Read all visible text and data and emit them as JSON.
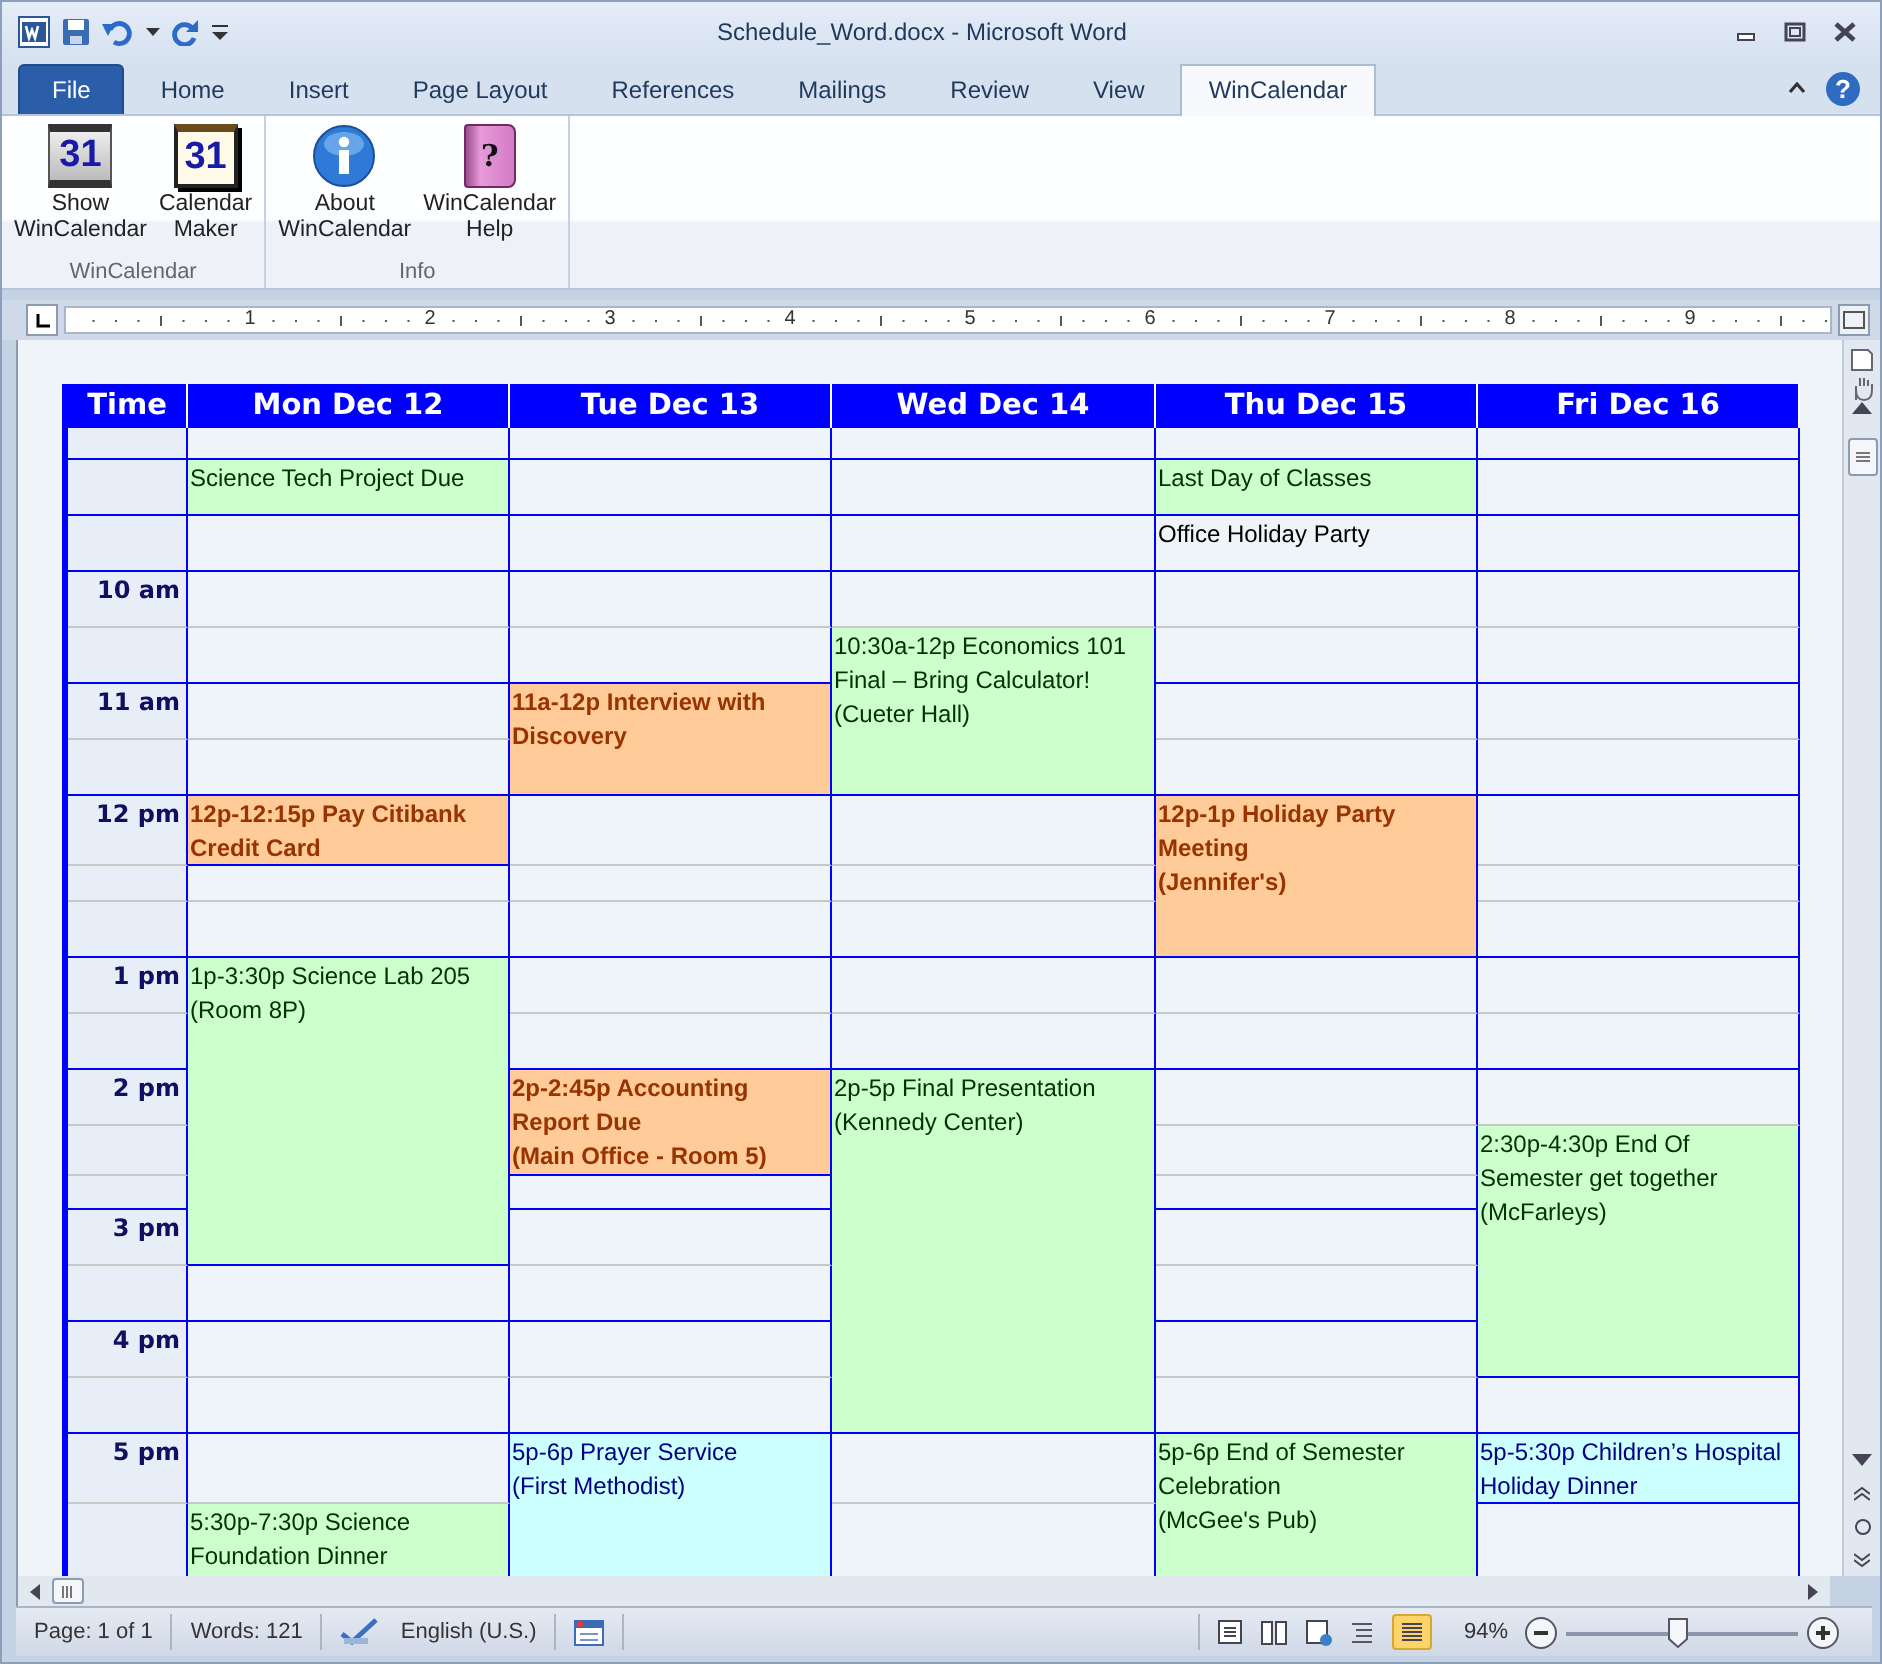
{
  "window": {
    "title": "Schedule_Word.docx - Microsoft Word"
  },
  "ribbon_tabs": [
    {
      "label": "File",
      "kind": "file",
      "selected": false
    },
    {
      "label": "Home",
      "kind": "tab",
      "selected": false
    },
    {
      "label": "Insert",
      "kind": "tab",
      "selected": false
    },
    {
      "label": "Page Layout",
      "kind": "tab",
      "selected": false
    },
    {
      "label": "References",
      "kind": "tab",
      "selected": false
    },
    {
      "label": "Mailings",
      "kind": "tab",
      "selected": false
    },
    {
      "label": "Review",
      "kind": "tab",
      "selected": false
    },
    {
      "label": "View",
      "kind": "tab",
      "selected": false
    },
    {
      "label": "WinCalendar",
      "kind": "tab",
      "selected": true
    }
  ],
  "help_button": {
    "text": "?"
  },
  "ribbon_groups": [
    {
      "label": "WinCalendar",
      "buttons": [
        {
          "label": "Show WinCalendar",
          "icon_text": "31"
        },
        {
          "label": "Calendar Maker",
          "icon_text": "31"
        }
      ]
    },
    {
      "label": "Info",
      "buttons": [
        {
          "label": "About WinCalendar"
        },
        {
          "label": "WinCalendar Help",
          "icon_text": "?"
        }
      ]
    }
  ],
  "ruler": {
    "labels": [
      "1",
      "2",
      "3",
      "4",
      "5",
      "6",
      "7",
      "8",
      "9"
    ]
  },
  "calendar": {
    "time_header": "Time",
    "columns": [
      "Mon Dec 12",
      "Tue Dec 13",
      "Wed Dec 14",
      "Thu Dec 15",
      "Fri Dec 16"
    ],
    "rows": [
      {
        "kind": "allday",
        "cells": [
          {
            "kind": "empty"
          },
          {
            "kind": "empty"
          },
          {
            "kind": "empty"
          },
          {
            "kind": "empty"
          },
          {
            "kind": "empty"
          }
        ]
      },
      {
        "kind": "allday",
        "cells": [
          {
            "kind": "event",
            "lines": [
              "Science Tech Project Due"
            ],
            "color": "#ccffcc",
            "bold": false
          },
          {
            "kind": "empty"
          },
          {
            "kind": "empty"
          },
          {
            "kind": "event",
            "lines": [
              "Last Day of Classes"
            ],
            "color": "#ccffcc",
            "bold": false
          },
          {
            "kind": "empty"
          }
        ]
      },
      {
        "kind": "allday",
        "cells": [
          {
            "kind": "empty"
          },
          {
            "kind": "empty"
          },
          {
            "kind": "empty"
          },
          {
            "kind": "event",
            "lines": [
              "Office Holiday Party"
            ],
            "bold": false
          },
          {
            "kind": "empty"
          }
        ]
      },
      {
        "kind": "slot",
        "time": "10 am",
        "cells": [
          {
            "kind": "empty"
          },
          {
            "kind": "empty"
          },
          {
            "kind": "empty"
          },
          {
            "kind": "empty"
          },
          {
            "kind": "empty"
          }
        ]
      },
      {
        "kind": "slot",
        "cells": [
          {
            "kind": "empty"
          },
          {
            "kind": "empty"
          },
          {
            "kind": "event",
            "lines": [
              "10:30a-12p Economics 101 Final – Bring Calculator!",
              "(Cueter Hall)"
            ],
            "color": "#ccffcc",
            "bold": false
          },
          {
            "kind": "empty"
          },
          {
            "kind": "empty"
          }
        ]
      },
      {
        "kind": "slot",
        "time": "11 am",
        "cells": [
          {
            "kind": "empty"
          },
          {
            "kind": "event",
            "lines": [
              "11a-12p Interview with Discovery"
            ],
            "color": "#ffcc99",
            "bold": true
          },
          {
            "kind": "continued"
          },
          {
            "kind": "empty"
          },
          {
            "kind": "empty"
          }
        ]
      },
      {
        "kind": "slot",
        "cells": [
          {
            "kind": "empty"
          },
          {
            "kind": "continued"
          },
          {
            "kind": "continued"
          },
          {
            "kind": "empty"
          },
          {
            "kind": "empty"
          }
        ]
      },
      {
        "kind": "slot",
        "time": "12 pm",
        "cells": [
          {
            "kind": "event",
            "lines": [
              "12p-12:15p Pay Citibank Credit Card"
            ],
            "color": "#ffcc99",
            "bold": true
          },
          {
            "kind": "empty"
          },
          {
            "kind": "empty"
          },
          {
            "kind": "event",
            "lines": [
              "12p-1p Holiday Party Meeting",
              "(Jennifer's)"
            ],
            "color": "#ffcc99",
            "bold": true
          },
          {
            "kind": "empty"
          }
        ]
      },
      {
        "kind": "slot",
        "cells": [
          {
            "kind": "empty"
          },
          {
            "kind": "empty"
          },
          {
            "kind": "empty"
          },
          {
            "kind": "continued"
          },
          {
            "kind": "empty"
          }
        ]
      },
      {
        "kind": "slot",
        "cells": [
          {
            "kind": "empty"
          },
          {
            "kind": "empty"
          },
          {
            "kind": "empty"
          },
          {
            "kind": "continued"
          },
          {
            "kind": "empty"
          }
        ]
      },
      {
        "kind": "slot",
        "time": "1 pm",
        "cells": [
          {
            "kind": "event",
            "lines": [
              "1p-3:30p Science Lab 205",
              "(Room 8P)"
            ],
            "color": "#ccffcc",
            "bold": false
          },
          {
            "kind": "empty"
          },
          {
            "kind": "empty"
          },
          {
            "kind": "empty"
          },
          {
            "kind": "empty"
          }
        ]
      },
      {
        "kind": "slot",
        "cells": [
          {
            "kind": "continued"
          },
          {
            "kind": "empty"
          },
          {
            "kind": "empty"
          },
          {
            "kind": "empty"
          },
          {
            "kind": "empty"
          }
        ]
      },
      {
        "kind": "slot",
        "time": "2 pm",
        "cells": [
          {
            "kind": "continued"
          },
          {
            "kind": "event",
            "lines": [
              "2p-2:45p Accounting Report Due",
              "(Main Office - Room 5)"
            ],
            "color": "#ffcc99",
            "bold": true
          },
          {
            "kind": "event",
            "lines": [
              "2p-5p Final Presentation",
              "(Kennedy Center)"
            ],
            "color": "#ccffcc",
            "bold": false
          },
          {
            "kind": "empty"
          },
          {
            "kind": "empty"
          }
        ]
      },
      {
        "kind": "slot",
        "cells": [
          {
            "kind": "continued"
          },
          {
            "kind": "continued"
          },
          {
            "kind": "continued"
          },
          {
            "kind": "empty"
          },
          {
            "kind": "event",
            "lines": [
              "2:30p-4:30p End Of Semester get together",
              "(McFarleys)"
            ],
            "color": "#ccffcc",
            "bold": false
          }
        ]
      },
      {
        "kind": "slot",
        "cells": [
          {
            "kind": "continued"
          },
          {
            "kind": "empty"
          },
          {
            "kind": "continued"
          },
          {
            "kind": "empty"
          },
          {
            "kind": "continued"
          }
        ]
      },
      {
        "kind": "slot",
        "time": "3 pm",
        "cells": [
          {
            "kind": "continued"
          },
          {
            "kind": "empty"
          },
          {
            "kind": "continued"
          },
          {
            "kind": "empty"
          },
          {
            "kind": "continued"
          }
        ]
      },
      {
        "kind": "slot",
        "cells": [
          {
            "kind": "empty"
          },
          {
            "kind": "empty"
          },
          {
            "kind": "continued"
          },
          {
            "kind": "empty"
          },
          {
            "kind": "continued"
          }
        ]
      },
      {
        "kind": "slot",
        "time": "4 pm",
        "cells": [
          {
            "kind": "empty"
          },
          {
            "kind": "empty"
          },
          {
            "kind": "continued"
          },
          {
            "kind": "empty"
          },
          {
            "kind": "continued"
          }
        ]
      },
      {
        "kind": "slot",
        "cells": [
          {
            "kind": "empty"
          },
          {
            "kind": "empty"
          },
          {
            "kind": "continued"
          },
          {
            "kind": "empty"
          },
          {
            "kind": "empty"
          }
        ]
      },
      {
        "kind": "slot",
        "time": "5 pm",
        "cells": [
          {
            "kind": "empty"
          },
          {
            "kind": "event",
            "lines": [
              "5p-6p Prayer Service",
              "(First Methodist)"
            ],
            "color": "#ccffff",
            "bold": false
          },
          {
            "kind": "empty"
          },
          {
            "kind": "event",
            "lines": [
              "5p-6p End of Semester Celebration",
              "(McGee's Pub)"
            ],
            "color": "#ccffcc",
            "bold": false
          },
          {
            "kind": "event",
            "lines": [
              "5p-5:30p Children’s Hospital Holiday Dinner"
            ],
            "color": "#ccffff",
            "bold": false
          }
        ]
      },
      {
        "kind": "slot",
        "cells": [
          {
            "kind": "event",
            "lines": [
              "5:30p-7:30p Science Foundation Dinner"
            ],
            "color": "#ccffcc",
            "bold": false
          },
          {
            "kind": "continued"
          },
          {
            "kind": "empty"
          },
          {
            "kind": "continued"
          },
          {
            "kind": "empty"
          }
        ]
      }
    ]
  },
  "status_bar": {
    "page": "Page: 1 of 1",
    "words": "Words: 121",
    "language": "English (U.S.)",
    "zoom": "94%",
    "zoom_slider": {
      "level": 0.48
    }
  }
}
